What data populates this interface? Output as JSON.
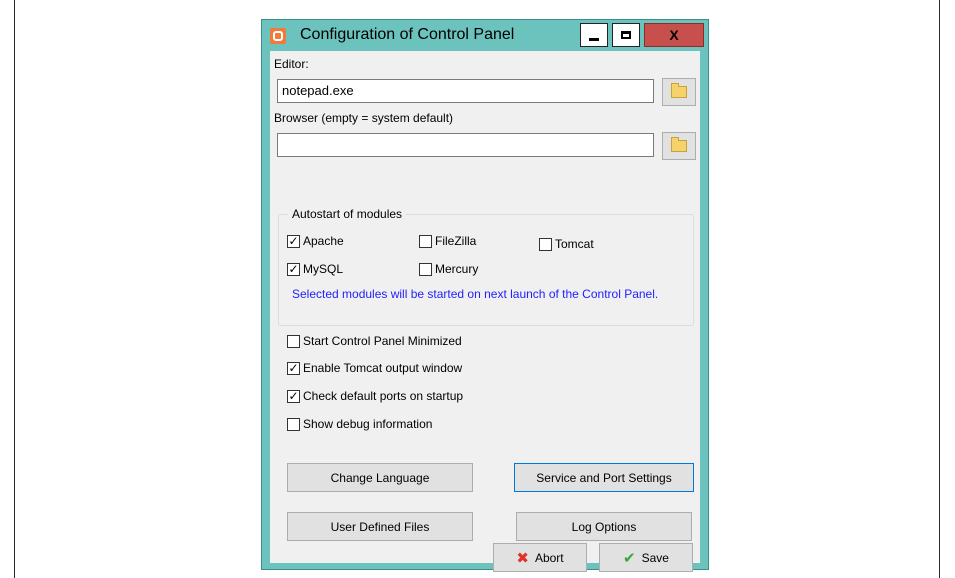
{
  "window": {
    "title": "Configuration of Control Panel",
    "close_label": "X"
  },
  "editor": {
    "label": "Editor:",
    "value": "notepad.exe"
  },
  "browser": {
    "label": "Browser (empty = system default)",
    "value": ""
  },
  "autostart": {
    "title": "Autostart of modules",
    "modules": {
      "apache": {
        "label": "Apache",
        "checked": true
      },
      "filezilla": {
        "label": "FileZilla",
        "checked": false
      },
      "tomcat": {
        "label": "Tomcat",
        "checked": false
      },
      "mysql": {
        "label": "MySQL",
        "checked": true
      },
      "mercury": {
        "label": "Mercury",
        "checked": false
      }
    },
    "note": "Selected modules will be started on next launch of the Control Panel."
  },
  "options": {
    "start_minimized": {
      "label": "Start Control Panel Minimized",
      "checked": false
    },
    "tomcat_output": {
      "label": "Enable Tomcat output window",
      "checked": true
    },
    "check_ports": {
      "label": "Check default ports on startup",
      "checked": true
    },
    "debug_info": {
      "label": "Show debug information",
      "checked": false
    }
  },
  "buttons": {
    "change_language": "Change Language",
    "service_port": "Service and Port Settings",
    "user_files": "User Defined Files",
    "log_options": "Log Options",
    "abort": "Abort",
    "save": "Save"
  },
  "icons": {
    "app": "xampp-icon",
    "folder": "folder-icon",
    "abort": "red-x-icon",
    "save": "green-check-icon"
  },
  "colors": {
    "window_frame": "#6cc3bd",
    "close_button": "#c7504c",
    "note_text": "#1f1fff"
  }
}
